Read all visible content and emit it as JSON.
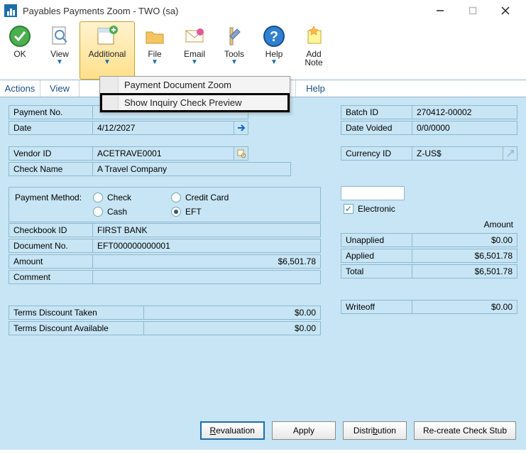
{
  "window": {
    "title": "Payables Payments Zoom  -  TWO (sa)"
  },
  "ribbon": {
    "ok": "OK",
    "view": "View",
    "additional": "Additional",
    "file": "File",
    "email": "Email",
    "tools": "Tools",
    "help": "Help",
    "addnote1": "Add",
    "addnote2": "Note"
  },
  "subbar": {
    "actions": "Actions",
    "view": "View",
    "help": "Help"
  },
  "dropdown": {
    "item1": "Payment Document Zoom",
    "item2": "Show Inquiry Check Preview"
  },
  "labels": {
    "payment_no": "Payment No.",
    "date": "Date",
    "vendor_id": "Vendor ID",
    "check_name": "Check Name",
    "payment_method": "Payment Method:",
    "check": "Check",
    "credit_card": "Credit Card",
    "cash": "Cash",
    "eft": "EFT",
    "electronic": "Electronic",
    "checkbook_id": "Checkbook ID",
    "document_no": "Document No.",
    "amount": "Amount",
    "comment": "Comment",
    "batch_id": "Batch ID",
    "date_voided": "Date Voided",
    "currency_id": "Currency ID",
    "amount_hdr": "Amount",
    "unapplied": "Unapplied",
    "applied": "Applied",
    "total": "Total",
    "tdt": "Terms Discount Taken",
    "tda": "Terms Discount Available",
    "writeoff": "Writeoff"
  },
  "values": {
    "date": "4/12/2027",
    "vendor_id": "ACETRAVE0001",
    "check_name": "A Travel Company",
    "checkbook_id": "FIRST BANK",
    "document_no": "EFT000000000001",
    "amount": "$6,501.78",
    "batch_id": "270412-00002",
    "date_voided": "0/0/0000",
    "currency_id": "Z-US$",
    "unapplied": "$0.00",
    "applied": "$6,501.78",
    "total": "$6,501.78",
    "tdt": "$0.00",
    "tda": "$0.00",
    "writeoff": "$0.00"
  },
  "buttons": {
    "revaluation": "Revaluation",
    "apply": "Apply",
    "distribution": "Distribution",
    "recreate": "Re-create Check Stub"
  }
}
